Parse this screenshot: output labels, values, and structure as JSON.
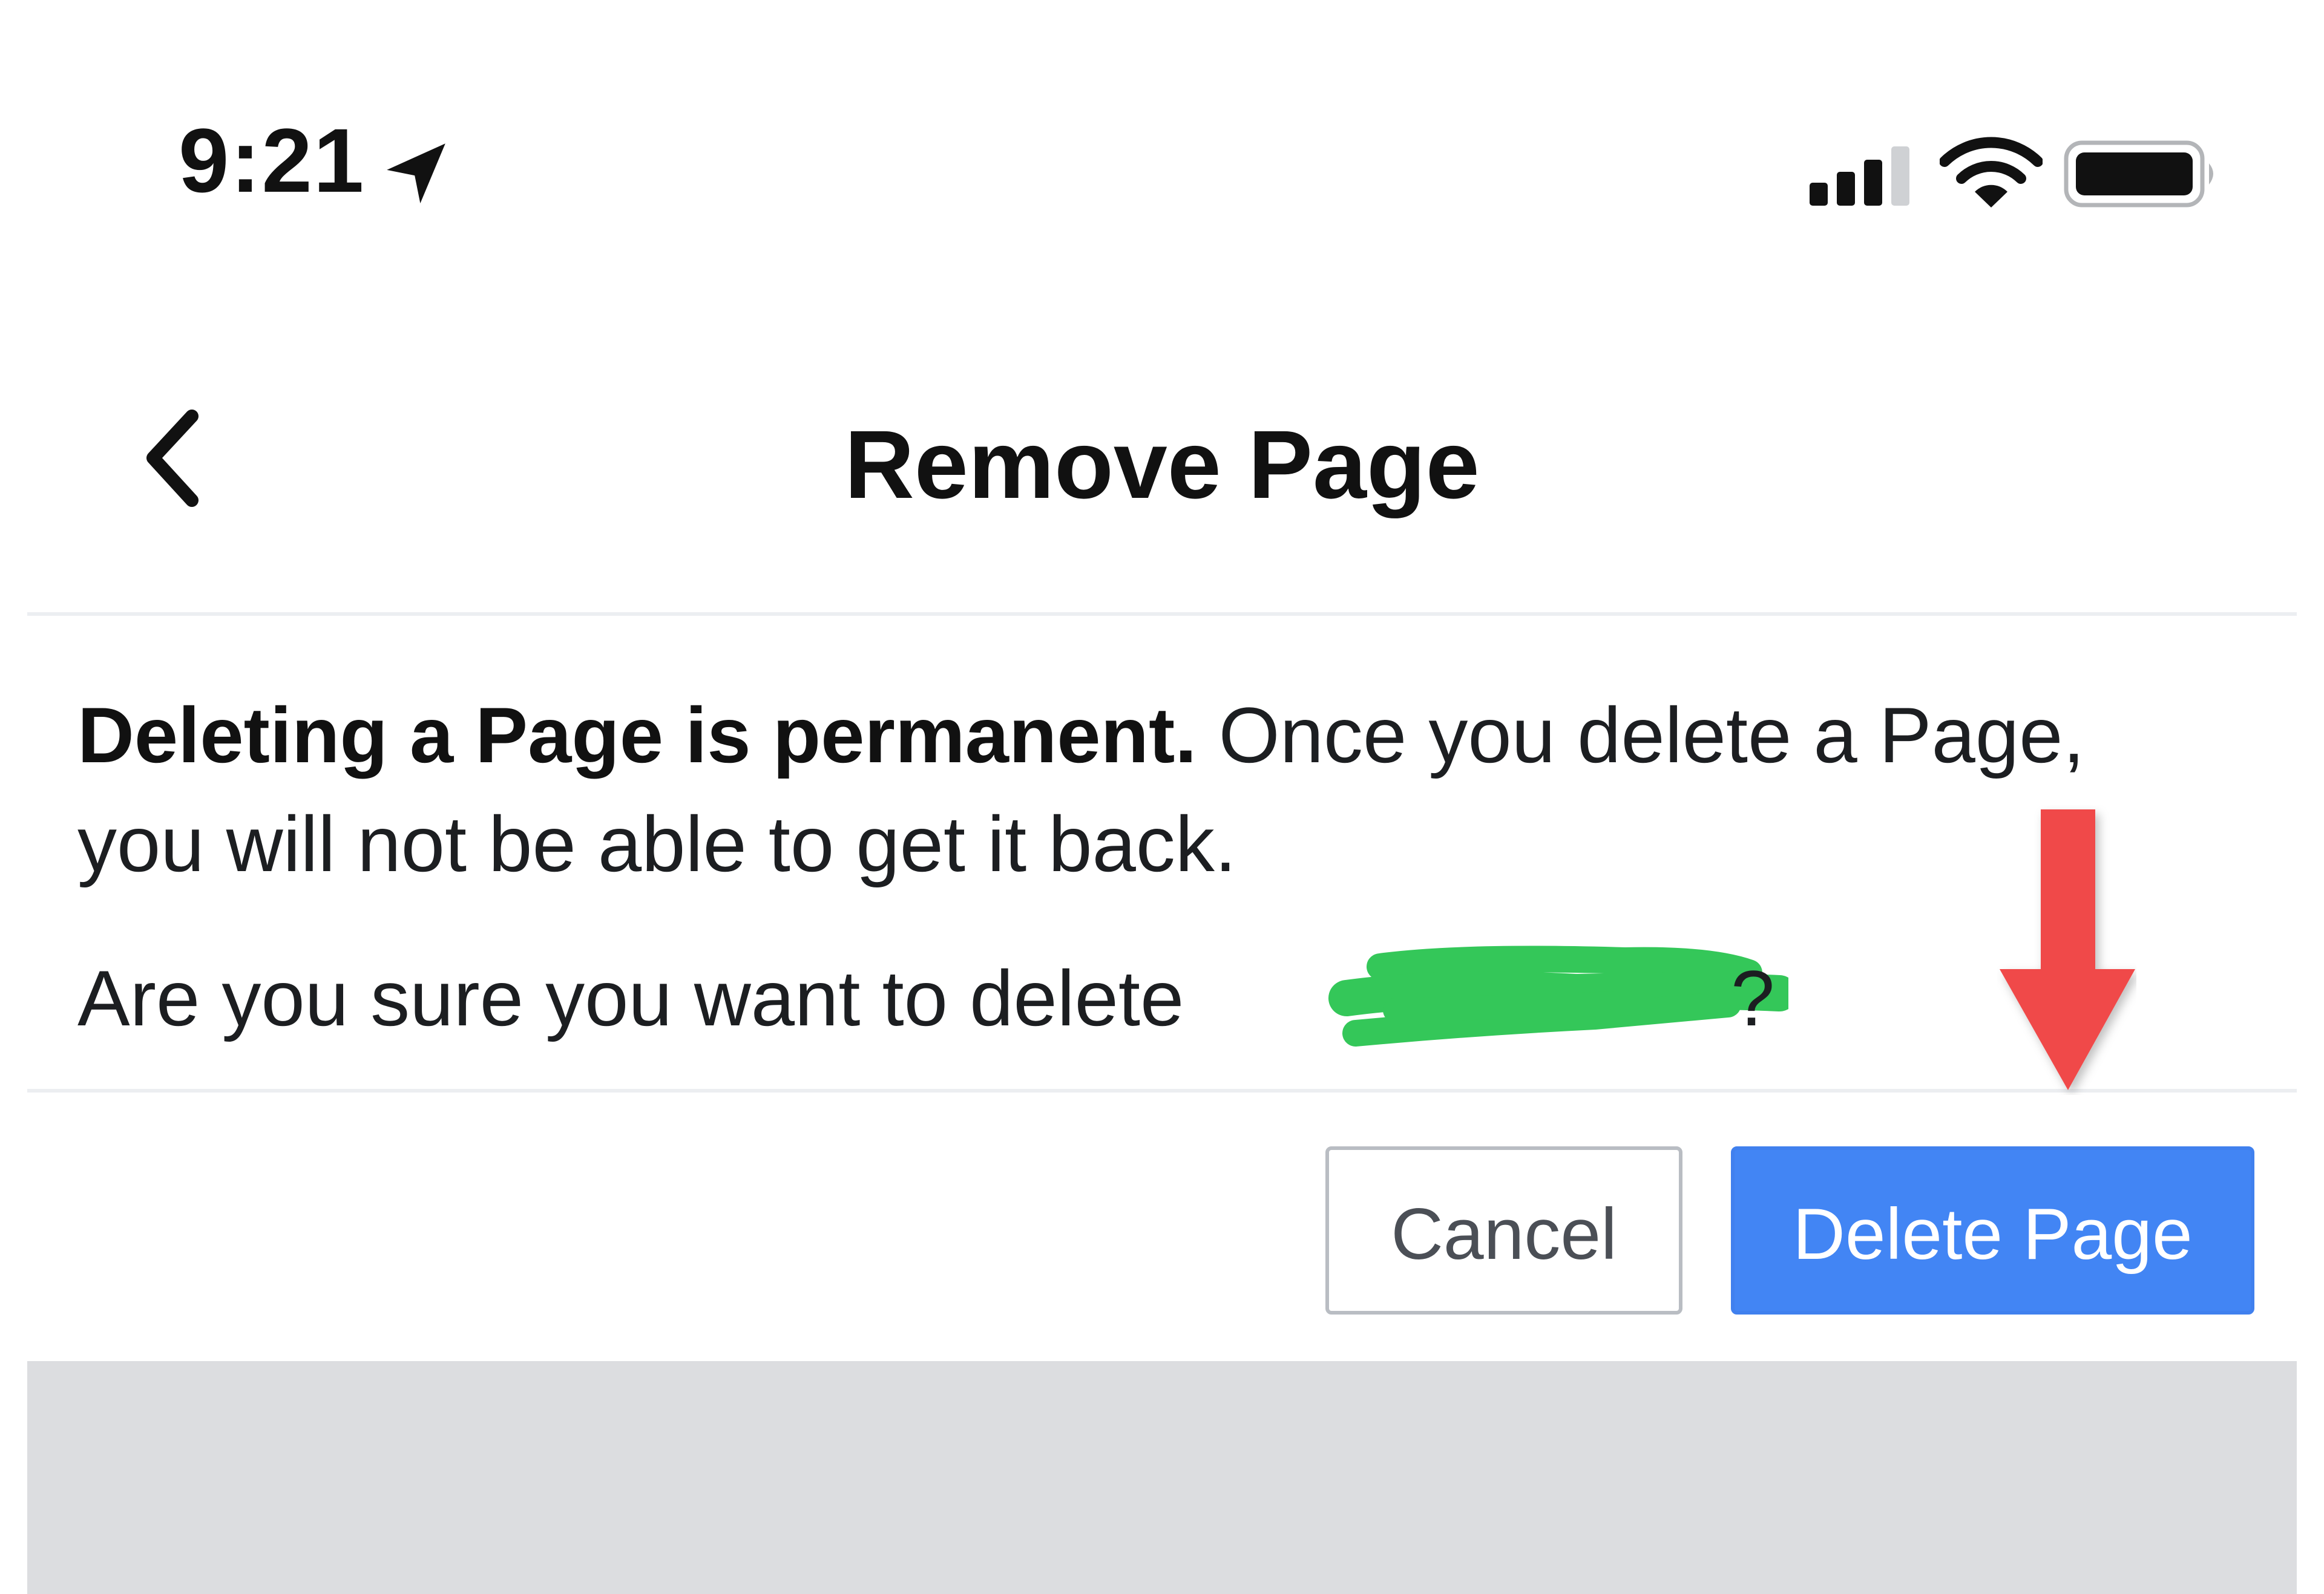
{
  "status_bar": {
    "time": "9:21",
    "icons": [
      "location-arrow-icon",
      "cellular-signal-icon",
      "wifi-icon",
      "battery-icon"
    ]
  },
  "header": {
    "back_icon": "chevron-left-icon",
    "title": "Remove Page"
  },
  "body": {
    "warning_bold": "Deleting a Page is permanent.",
    "warning_text": " Once you delete a Page, you will not be able to get it back.",
    "question_prefix": "Are you sure you want to delete",
    "question_suffix": "?"
  },
  "buttons": {
    "cancel_label": "Cancel",
    "delete_label": "Delete Page"
  },
  "colors": {
    "primary_button": "#4285f4",
    "annotation_arrow": "#f04848",
    "redaction": "#34c759",
    "footer": "#dcdde0"
  }
}
